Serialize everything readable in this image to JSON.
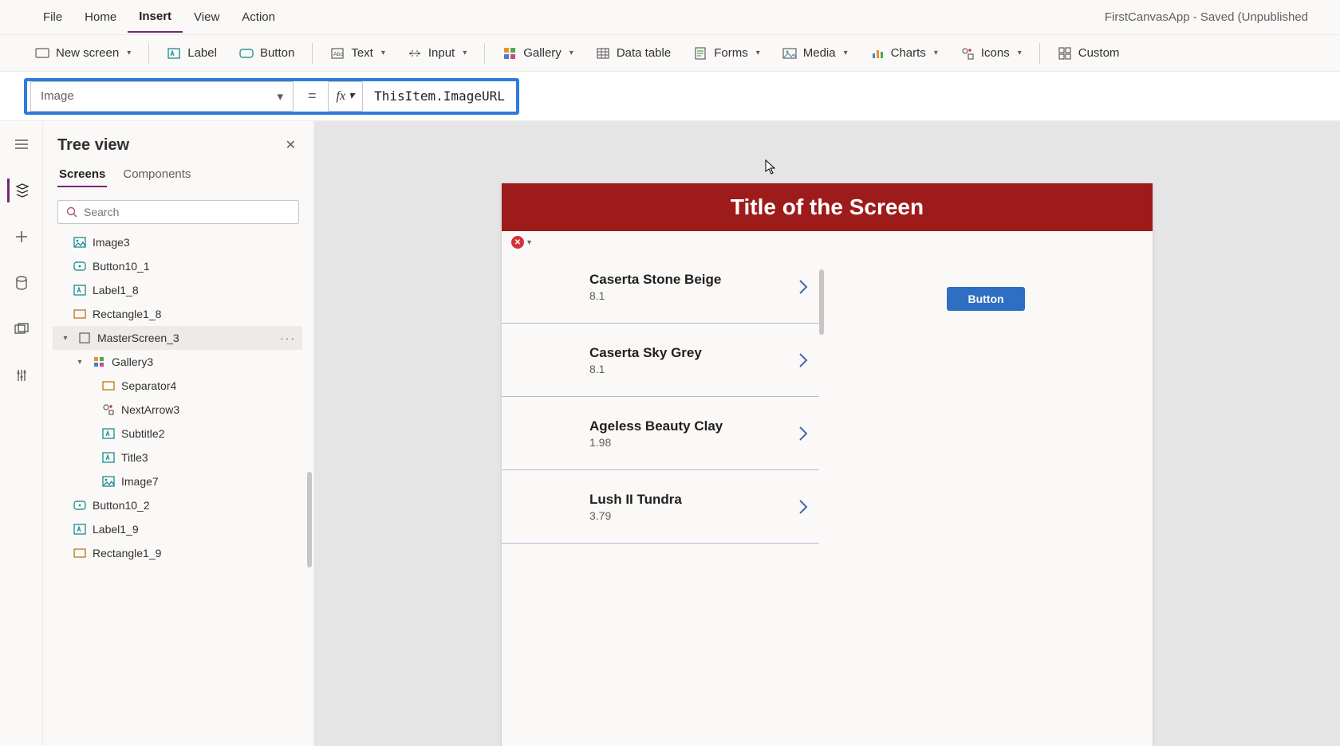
{
  "app_title": "FirstCanvasApp - Saved (Unpublished",
  "menubar": {
    "items": [
      "File",
      "Home",
      "Insert",
      "View",
      "Action"
    ],
    "active_index": 2
  },
  "ribbon": {
    "new_screen": "New screen",
    "label": "Label",
    "button": "Button",
    "text": "Text",
    "input": "Input",
    "gallery": "Gallery",
    "data_table": "Data table",
    "forms": "Forms",
    "media": "Media",
    "charts": "Charts",
    "icons": "Icons",
    "custom": "Custom"
  },
  "formula_bar": {
    "property": "Image",
    "equals": "=",
    "fx": "fx",
    "expression": "ThisItem.ImageURL"
  },
  "treeview": {
    "title": "Tree view",
    "tabs": {
      "a": "Screens",
      "b": "Components",
      "active": "a"
    },
    "search_placeholder": "Search",
    "items": [
      {
        "label": "Image3",
        "icon": "image-ic",
        "indent": 1
      },
      {
        "label": "Button10_1",
        "icon": "button-ic",
        "indent": 1
      },
      {
        "label": "Label1_8",
        "icon": "label-ic",
        "indent": 1
      },
      {
        "label": "Rectangle1_8",
        "icon": "rect-ic",
        "indent": 1
      },
      {
        "label": "MasterScreen_3",
        "icon": "screen-ic",
        "indent": 0,
        "selected": true,
        "expand": true,
        "more": true
      },
      {
        "label": "Gallery3",
        "icon": "gallery-ic",
        "indent": 1,
        "expand": true
      },
      {
        "label": "Separator4",
        "icon": "rect-ic",
        "indent": 3
      },
      {
        "label": "NextArrow3",
        "icon": "icons-ic",
        "indent": 3
      },
      {
        "label": "Subtitle2",
        "icon": "label-ic",
        "indent": 3
      },
      {
        "label": "Title3",
        "icon": "label-ic",
        "indent": 3
      },
      {
        "label": "Image7",
        "icon": "image-ic",
        "indent": 3
      },
      {
        "label": "Button10_2",
        "icon": "button-ic",
        "indent": 1
      },
      {
        "label": "Label1_9",
        "icon": "label-ic",
        "indent": 1
      },
      {
        "label": "Rectangle1_9",
        "icon": "rect-ic",
        "indent": 1
      }
    ]
  },
  "canvas": {
    "screen_title": "Title of the Screen",
    "button_label": "Button",
    "gallery": [
      {
        "title": "Caserta Stone Beige",
        "subtitle": "8.1"
      },
      {
        "title": "Caserta Sky Grey",
        "subtitle": "8.1"
      },
      {
        "title": "Ageless Beauty Clay",
        "subtitle": "1.98"
      },
      {
        "title": "Lush II Tundra",
        "subtitle": "3.79"
      }
    ]
  }
}
